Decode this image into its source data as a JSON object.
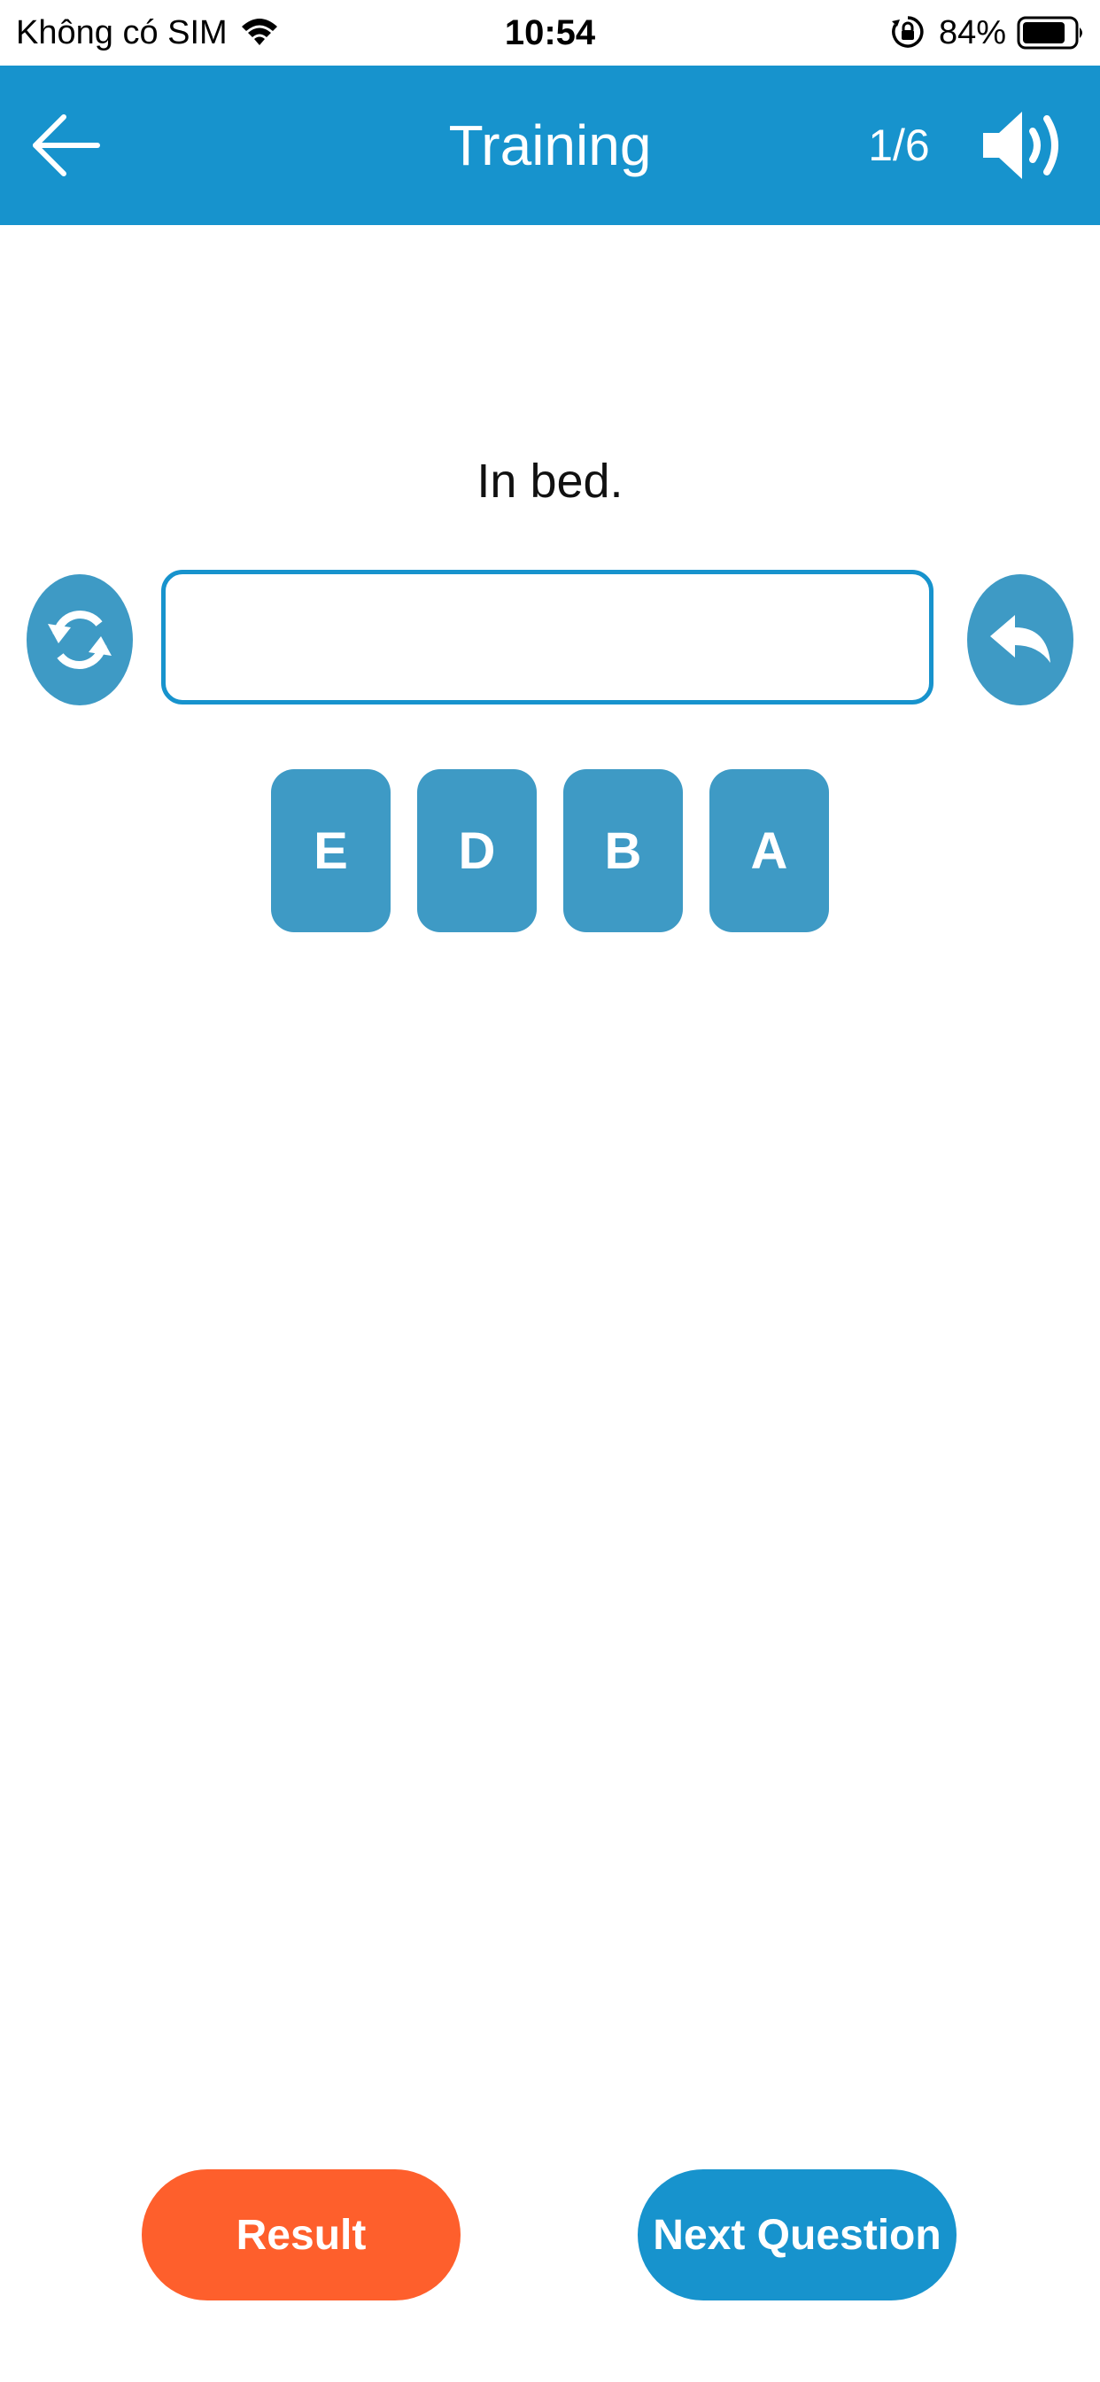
{
  "status_bar": {
    "carrier": "Không có SIM",
    "time": "10:54",
    "battery_percent": "84%",
    "battery_level": 0.84
  },
  "header": {
    "title": "Training",
    "progress": "1/6",
    "background_color": "#1793cd",
    "back_icon": "arrow-left-icon",
    "speaker_icon": "speaker-volume-icon"
  },
  "question": {
    "prompt": "In bed.",
    "answer_value": "",
    "answer_placeholder": "",
    "refresh_icon": "refresh-icon",
    "undo_icon": "undo-icon"
  },
  "letter_tiles": [
    "E",
    "D",
    "B",
    "A"
  ],
  "footer": {
    "result_label": "Result",
    "next_label": "Next Question",
    "result_color": "#fe5f2c",
    "next_color": "#1793cd"
  }
}
